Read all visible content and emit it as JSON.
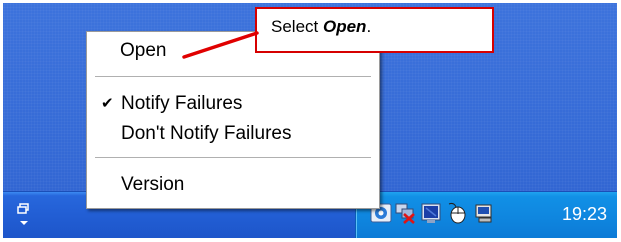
{
  "menu": {
    "items": [
      {
        "label": "Open",
        "checked": false
      },
      {
        "label": "Notify Failures",
        "checked": true
      },
      {
        "label": "Don't Notify Failures",
        "checked": false
      },
      {
        "label": "Version",
        "checked": false
      }
    ],
    "check_glyph": "✔"
  },
  "callout": {
    "prefix": "Select ",
    "emphasis": "Open",
    "suffix": ".",
    "border_color": "#d60000"
  },
  "taskbar": {
    "restore_icon": "restore-window-icon",
    "tray_icons": [
      "network-share-icon",
      "network-disconnected-icon",
      "monitor-icon",
      "mouse-icon",
      "keyboard-icon"
    ],
    "clock": "19:23",
    "color": "#225ed4",
    "tray_color": "#0f86df"
  },
  "desktop": {
    "color": "#3a6ed8"
  }
}
